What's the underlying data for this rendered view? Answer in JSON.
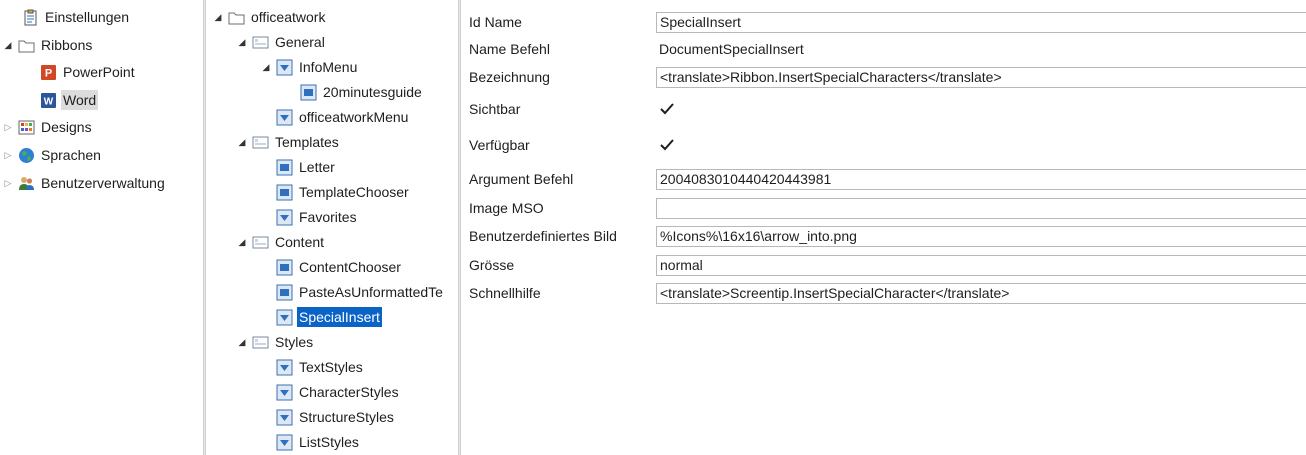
{
  "left_tree": [
    {
      "label": "Einstellungen",
      "icon": "clipboard-icon"
    },
    {
      "label": "Ribbons",
      "icon": "folder-icon"
    },
    {
      "label": "PowerPoint",
      "icon": "powerpoint-icon"
    },
    {
      "label": "Word",
      "icon": "word-icon",
      "selected": true
    },
    {
      "label": "Designs",
      "icon": "palette-icon"
    },
    {
      "label": "Sprachen",
      "icon": "globe-icon"
    },
    {
      "label": "Benutzerverwaltung",
      "icon": "users-icon"
    }
  ],
  "ribbon_tree": [
    {
      "label": "officeatwork",
      "icon": "folder-icon"
    },
    {
      "label": "General",
      "icon": "group-icon"
    },
    {
      "label": "InfoMenu",
      "icon": "menu-icon"
    },
    {
      "label": "20minutesguide",
      "icon": "button-icon"
    },
    {
      "label": "officeatworkMenu",
      "icon": "menu-icon"
    },
    {
      "label": "Templates",
      "icon": "group-icon"
    },
    {
      "label": "Letter",
      "icon": "button-icon"
    },
    {
      "label": "TemplateChooser",
      "icon": "button-icon"
    },
    {
      "label": "Favorites",
      "icon": "menu-icon"
    },
    {
      "label": "Content",
      "icon": "group-icon"
    },
    {
      "label": "ContentChooser",
      "icon": "button-icon"
    },
    {
      "label": "PasteAsUnformattedTe",
      "icon": "button-icon"
    },
    {
      "label": "SpecialInsert",
      "icon": "menu-icon",
      "selected": true
    },
    {
      "label": "Styles",
      "icon": "group-icon"
    },
    {
      "label": "TextStyles",
      "icon": "menu-icon"
    },
    {
      "label": "CharacterStyles",
      "icon": "menu-icon"
    },
    {
      "label": "StructureStyles",
      "icon": "menu-icon"
    },
    {
      "label": "ListStyles",
      "icon": "menu-icon"
    }
  ],
  "properties": [
    {
      "key": "Id Name",
      "value": "SpecialInsert",
      "kind": "input"
    },
    {
      "key": "Name Befehl",
      "value": "DocumentSpecialInsert",
      "kind": "text"
    },
    {
      "key": "Bezeichnung",
      "value": "<translate>Ribbon.InsertSpecialCharacters</translate>",
      "kind": "input"
    },
    {
      "key": "Sichtbar",
      "value": "",
      "kind": "checkbox",
      "checked": true
    },
    {
      "key": "Verfügbar",
      "value": "",
      "kind": "checkbox",
      "checked": true
    },
    {
      "key": "Argument Befehl",
      "value": "2004083010440420443981",
      "kind": "input"
    },
    {
      "key": "Image MSO",
      "value": "",
      "kind": "input"
    },
    {
      "key": "Benutzerdefiniertes Bild",
      "value": "%Icons%\\16x16\\arrow_into.png",
      "kind": "input"
    },
    {
      "key": "Grösse",
      "value": "normal",
      "kind": "input"
    },
    {
      "key": "Schnellhilfe",
      "value": "<translate>Screentip.InsertSpecialCharacter</translate>",
      "kind": "input"
    }
  ],
  "colors": {
    "selection": "#0a64c8",
    "accent_icon": "#2f6fbf"
  }
}
